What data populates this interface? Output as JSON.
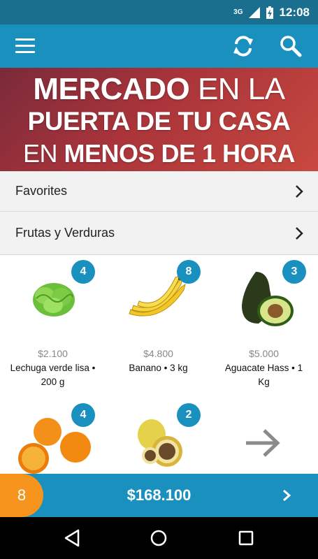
{
  "status": {
    "network": "3G",
    "time": "12:08"
  },
  "appbar": {
    "menu_icon": "hamburger-menu-icon",
    "refresh_icon": "refresh-icon",
    "search_icon": "search-icon",
    "color": "#1a90bf"
  },
  "banner": {
    "line1_bold": "MERCADO",
    "line1_rest": " EN LA",
    "line2": "PUERTA DE TU CASA",
    "line3_thin": "EN ",
    "line3_bold": "MENOS DE 1 HORA"
  },
  "categories": [
    {
      "label": "Favorites"
    },
    {
      "label": "Frutas y Verduras"
    }
  ],
  "products": [
    {
      "badge": "4",
      "price": "$2.100",
      "name": "Lechuga verde lisa • 200 g",
      "image": "lettuce"
    },
    {
      "badge": "8",
      "price": "$4.800",
      "name": "Banano • 3 kg",
      "image": "banana"
    },
    {
      "badge": "3",
      "price": "$5.000",
      "name": "Aguacate Hass • 1 Kg",
      "image": "avocado"
    },
    {
      "badge": "4",
      "price": "",
      "name": "",
      "image": "orange"
    },
    {
      "badge": "2",
      "price": "",
      "name": "",
      "image": "passion-fruit"
    }
  ],
  "more_icon": "arrow-right-icon",
  "cart": {
    "count": "8",
    "total": "$168.100",
    "accent": "#f7941d"
  },
  "navbar": {
    "back_icon": "back-triangle-icon",
    "home_icon": "home-circle-icon",
    "recents_icon": "recents-square-icon"
  }
}
